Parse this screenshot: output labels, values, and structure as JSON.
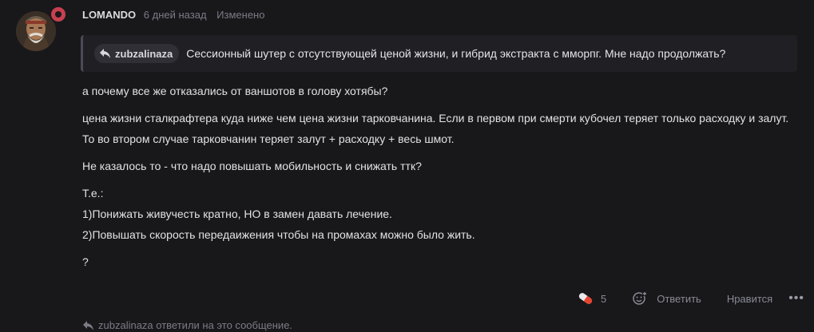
{
  "post": {
    "author": "LOMANDO",
    "time": "6 дней назад",
    "edited": "Изменено",
    "quote": {
      "user": "zubzalinaza",
      "text": "Сессионный шутер с отсутствующей ценой жизни, и гибрид экстракта с мморпг. Мне надо продолжать?"
    },
    "paragraphs": [
      [
        "а почему все же отказались от ваншотов в голову хотябы?"
      ],
      [
        "цена жизни сталкрафтера куда ниже чем цена жизни тарковчанина. Если в первом при смерти кубочел теряет только расходку и залут.",
        "То во втором случае тарковчанин теряет залут + расходку + весь шмот."
      ],
      [
        "Не казалось то - что надо повышать мобильность и снижать ттк?"
      ],
      [
        "Т.е.:",
        "1)Понижать живучесть кратно, НО в замен давать лечение.",
        "2)Повышать скорость передаижения чтобы на промахах можно было жить."
      ],
      [
        "?"
      ]
    ]
  },
  "actions": {
    "reaction_count": "5",
    "reply_label": "Ответить",
    "like_label": "Нравится",
    "more_label": "•••"
  },
  "footer": {
    "replied_text": "zubzalinaza ответили на это сообщение."
  },
  "colors": {
    "background": "#18181b",
    "quote_bg": "#202024",
    "muted": "#7b7b85",
    "badge": "#c8404f",
    "pill_red": "#e8432f"
  },
  "icons": {
    "reply_arrow": "reply-arrow-icon",
    "pill": "pill-icon",
    "emoji_add": "add-reaction-icon",
    "badge": "member-badge-icon"
  }
}
